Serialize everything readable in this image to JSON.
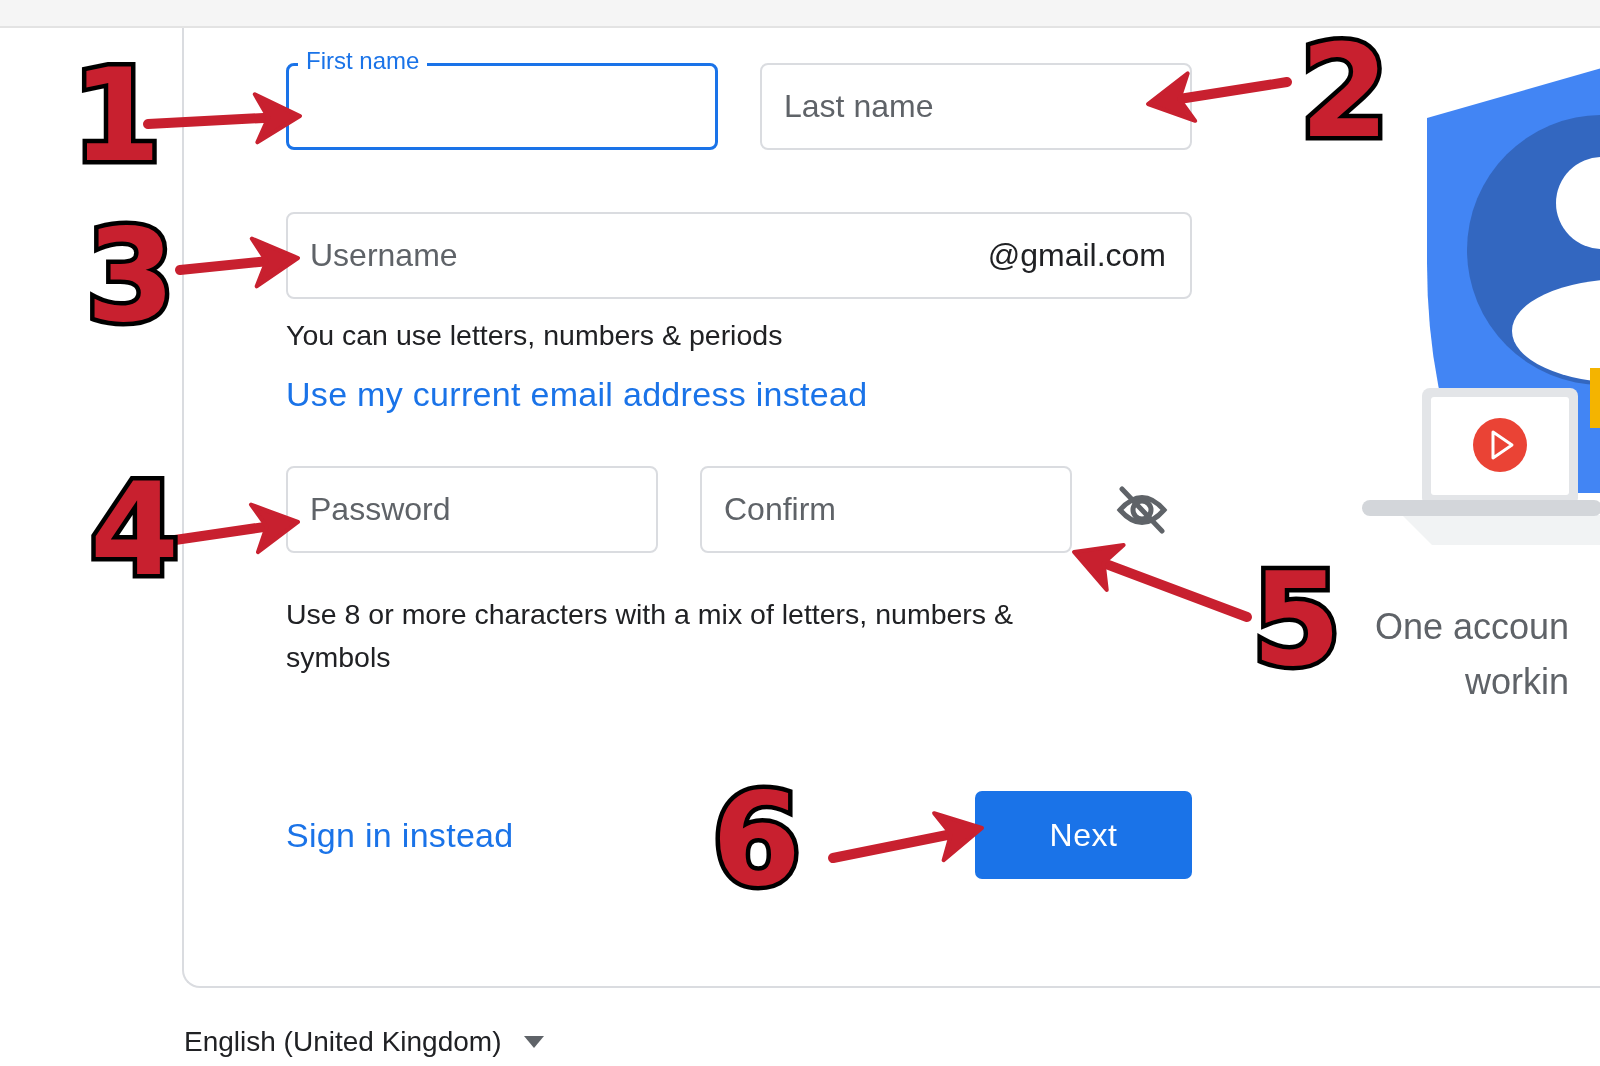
{
  "name_fields": [
    {
      "label": "First name",
      "focused": true
    },
    {
      "placeholder": "Last name",
      "focused": false
    }
  ],
  "username": {
    "placeholder": "Username",
    "suffix": "@gmail.com",
    "focused": false
  },
  "username_hint": "You can use letters, numbers & periods",
  "alt_email_link": "Use my current email address instead",
  "password_fields": [
    {
      "placeholder": "Password",
      "focused": false
    },
    {
      "placeholder": "Confirm",
      "focused": false
    }
  ],
  "password_hint": "Use 8 or more characters with a mix of letters, numbers & symbols",
  "sign_in_link": "Sign in instead",
  "next_button": "Next",
  "side_text": [
    "One accoun",
    "workin"
  ],
  "language": "English (United Kingdom)",
  "annotations": [
    {
      "label": "1"
    },
    {
      "label": "2"
    },
    {
      "label": "3"
    },
    {
      "label": "4"
    },
    {
      "label": "5"
    },
    {
      "label": "6"
    }
  ]
}
